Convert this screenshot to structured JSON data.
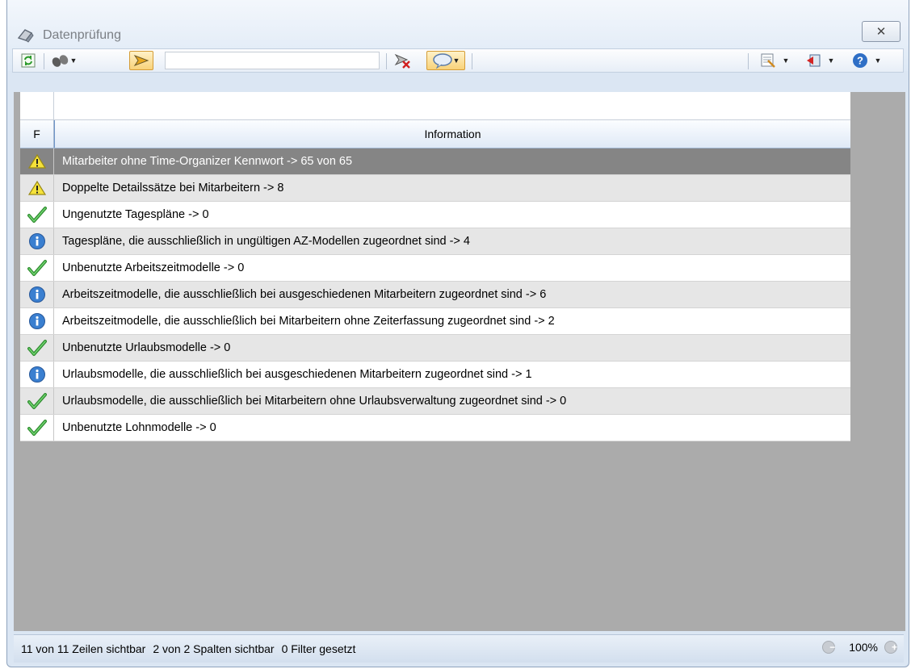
{
  "window": {
    "title": "Datenprüfung",
    "close_glyph": "✕"
  },
  "toolbar": {
    "search_value": "",
    "search_placeholder": "",
    "icons": [
      "refresh-icon",
      "binoculars-icon",
      "filter-funnel-icon",
      "clear-filter-icon",
      "comment-bubble-icon",
      "export-icon",
      "exit-icon",
      "help-icon"
    ]
  },
  "grid": {
    "columns": [
      {
        "label": "F"
      },
      {
        "label": "Information"
      }
    ],
    "rows": [
      {
        "status": "warning",
        "text": "Mitarbeiter ohne Time-Organizer Kennwort -> 65 von 65"
      },
      {
        "status": "warning",
        "text": "Doppelte Detailssätze bei Mitarbeitern -> 8"
      },
      {
        "status": "ok",
        "text": "Ungenutzte Tagespläne -> 0"
      },
      {
        "status": "info",
        "text": "Tagespläne, die ausschließlich in ungültigen AZ-Modellen zugeordnet sind -> 4"
      },
      {
        "status": "ok",
        "text": "Unbenutzte Arbeitszeitmodelle -> 0"
      },
      {
        "status": "info",
        "text": "Arbeitszeitmodelle, die ausschließlich bei ausgeschiedenen Mitarbeitern zugeordnet sind -> 6"
      },
      {
        "status": "info",
        "text": "Arbeitszeitmodelle, die ausschließlich bei Mitarbeitern ohne Zeiterfassung zugeordnet sind -> 2"
      },
      {
        "status": "ok",
        "text": "Unbenutzte Urlaubsmodelle -> 0"
      },
      {
        "status": "info",
        "text": "Urlaubsmodelle, die ausschließlich bei ausgeschiedenen Mitarbeitern zugeordnet sind -> 1"
      },
      {
        "status": "ok",
        "text": "Urlaubsmodelle, die ausschließlich bei Mitarbeitern ohne Urlaubsverwaltung zugeordnet sind -> 0"
      },
      {
        "status": "ok",
        "text": "Unbenutzte Lohnmodelle -> 0"
      }
    ]
  },
  "statusbar": {
    "rows_visible": "11 von 11 Zeilen sichtbar",
    "cols_visible": "2 von 2 Spalten sichtbar",
    "filters": "0 Filter gesetzt",
    "zoom": "100%",
    "zoom_out_glyph": "−",
    "zoom_in_glyph": "+"
  },
  "colors": {
    "selected_row": "#858585",
    "alt_row": "#e6e6e6",
    "grid_background": "#ababab",
    "header_accent": "#6f95c8"
  }
}
